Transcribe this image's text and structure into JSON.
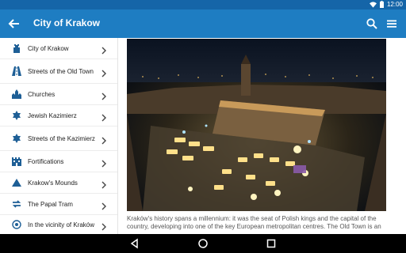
{
  "status_bar": {
    "time": "12:00"
  },
  "app_bar": {
    "title": "City of Krakow"
  },
  "sidebar": {
    "items": [
      {
        "label": "City of Krakow",
        "icon": "castle-icon"
      },
      {
        "label": "Streets of the Old Town",
        "icon": "road-icon"
      },
      {
        "label": "Churches",
        "icon": "church-icon"
      },
      {
        "label": "Jewish Kazimierz",
        "icon": "star-of-david-icon"
      },
      {
        "label": "Streets of the Kazimierz",
        "icon": "star-of-david-icon"
      },
      {
        "label": "Fortifications",
        "icon": "fortification-icon"
      },
      {
        "label": "Krakow's Mounds",
        "icon": "mound-icon"
      },
      {
        "label": "The Papal Tram",
        "icon": "tram-icon"
      },
      {
        "label": "In the vicinity of Kraków",
        "icon": "target-icon"
      }
    ]
  },
  "content": {
    "image": "Aerial night view of Kraków Main Market Square with illuminated Christmas market stalls",
    "text": "Kraków's history spans a millennium: it was the seat of Polish kings and the capital of the country, developing into one of the key European metropolitan centres. The Old Town is an"
  },
  "colors": {
    "status_bar": "#1565a8",
    "app_bar": "#1e7dc2",
    "icon": "#1e5f96"
  }
}
